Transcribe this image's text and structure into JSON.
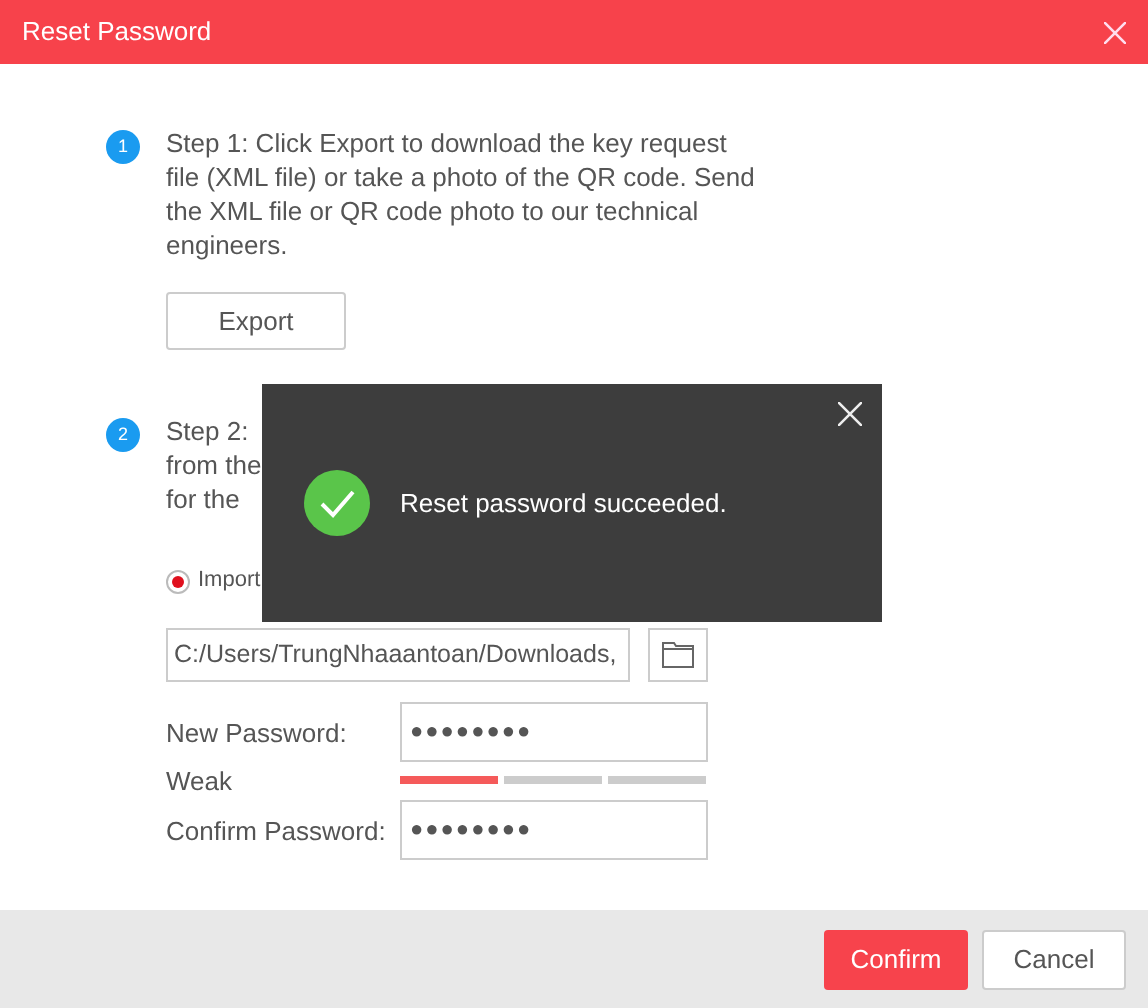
{
  "window": {
    "title": "Reset Password"
  },
  "steps": [
    {
      "number": "1",
      "text": "Step 1: Click Export to download the key request file (XML file) or take a photo of the QR code. Send the XML file or QR code photo to our technical engineers.",
      "button": "Export"
    },
    {
      "number": "2",
      "lines": [
        "Step 2:",
        "from the",
        "for the"
      ]
    }
  ],
  "import_option": {
    "label": "Import",
    "selected": true
  },
  "file_path": {
    "value": "C:/Users/TrungNhaaantoan/Downloads,"
  },
  "new_password": {
    "label": "New Password:",
    "value": "●●●●●●●●"
  },
  "strength": {
    "label": "Weak",
    "level": 0.32
  },
  "confirm_password": {
    "label": "Confirm Password:",
    "value": "●●●●●●●●"
  },
  "buttons": [
    {
      "label": "Confirm",
      "kind": "primary"
    },
    {
      "label": "Cancel",
      "kind": "secondary"
    }
  ],
  "toast": {
    "message": "Reset password succeeded."
  }
}
